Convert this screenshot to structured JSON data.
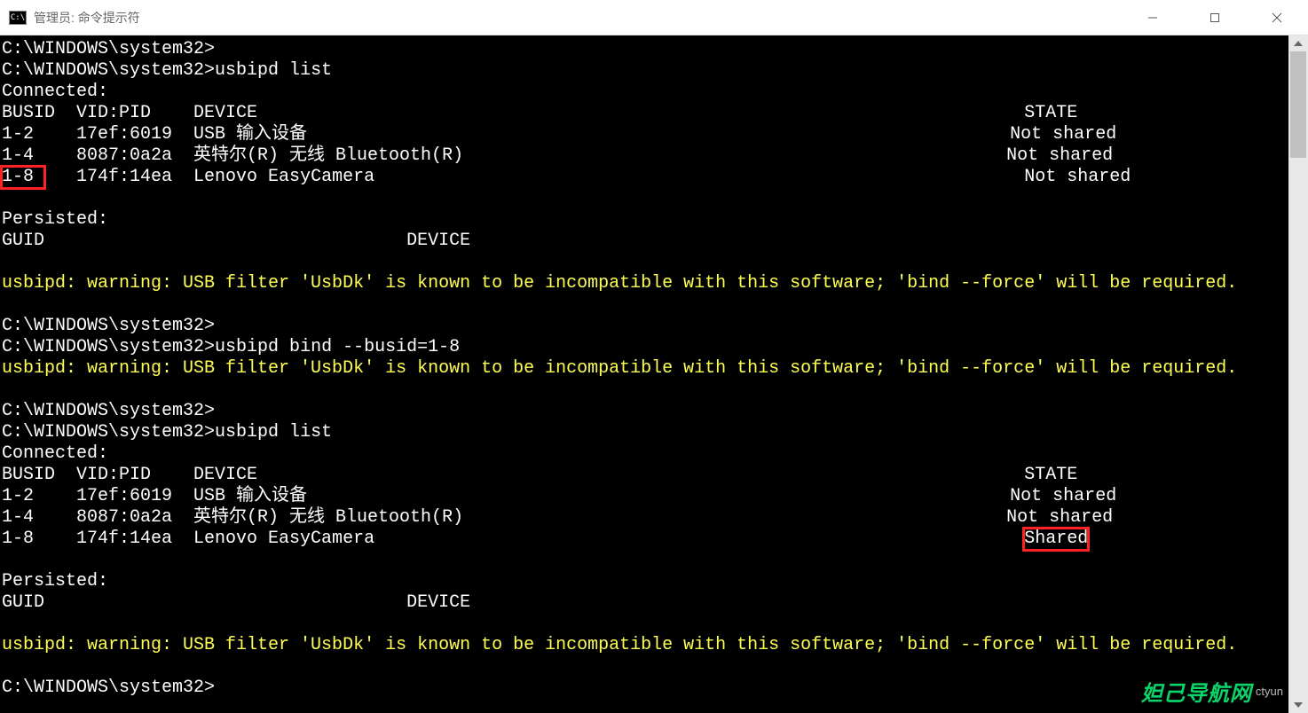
{
  "window": {
    "icon_text": "C:\\",
    "title": "管理员: 命令提示符"
  },
  "terminal": {
    "prompt": "C:\\WINDOWS\\system32>",
    "cmd_list": "usbipd list",
    "cmd_bind": "usbipd bind --busid=1-8",
    "connected_label": "Connected:",
    "persisted_label": "Persisted:",
    "header_busid": "BUSID  VID:PID    DEVICE                                                                        STATE",
    "header_guid": "GUID                                  DEVICE",
    "warning": "usbipd: warning: USB filter 'UsbDk' is known to be incompatible with this software; 'bind --force' will be required.",
    "row1_a": "1-2    17ef:6019  USB 输入设备                                                                  Not shared",
    "row1_b": "1-4    8087:0a2a  英特尔(R) 无线 Bluetooth(R)                                                   Not shared",
    "row1_c_bus": "1-8 ",
    "row1_c_rest": "   174f:14ea  Lenovo EasyCamera                                                             Not shared",
    "row2_a": "1-2    17ef:6019  USB 输入设备                                                                  Not shared",
    "row2_b": "1-4    8087:0a2a  英特尔(R) 无线 Bluetooth(R)                                                   Not shared",
    "row2_c_pre": "1-8    174f:14ea  Lenovo EasyCamera                                                             ",
    "row2_c_shared": "Shared"
  },
  "watermark": {
    "text1": "妲己导航网",
    "text2": "ctyun"
  }
}
